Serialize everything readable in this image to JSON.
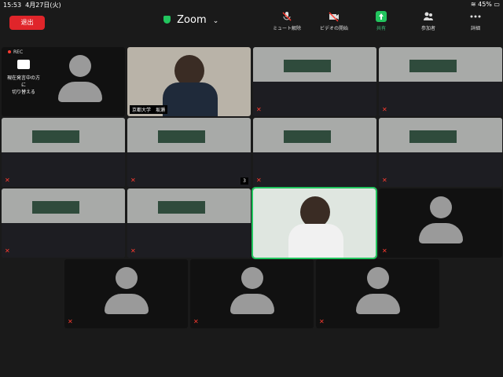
{
  "status": {
    "time": "15:53",
    "date": "4月27日(火)",
    "battery": "45%"
  },
  "leave_label": "退出",
  "title": "Zoom",
  "toolbar": [
    {
      "label": "ミュート解除",
      "icon": "mic-muted-icon"
    },
    {
      "label": "ビデオの開始",
      "icon": "video-off-icon"
    },
    {
      "label": "共有",
      "icon": "share-icon"
    },
    {
      "label": "参加者",
      "icon": "participants-icon"
    },
    {
      "label": "詳細",
      "icon": "more-icon"
    }
  ],
  "self_tile": {
    "rec": "REC",
    "line1": "現在発言中の方に",
    "line2": "切り替える"
  },
  "speaker_label": "京都大学　坂瀬",
  "tile_label_3": "3"
}
